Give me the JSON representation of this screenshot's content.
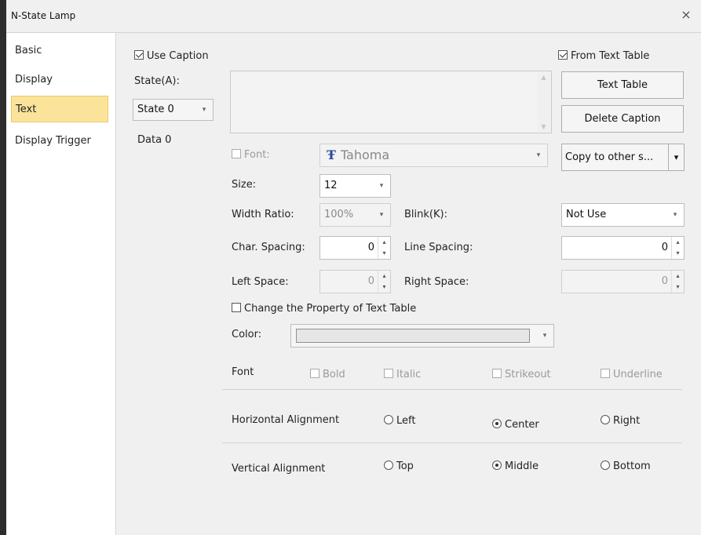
{
  "window": {
    "title": "N-State Lamp",
    "close_glyph": "×"
  },
  "nav": {
    "items": [
      "Basic",
      "Display",
      "Text",
      "Display Trigger"
    ],
    "selected": "Text"
  },
  "caption": {
    "use_caption_label": "Use Caption",
    "use_caption_checked": true,
    "from_text_table_label": "From Text Table",
    "from_text_table_checked": true,
    "state_label": "State(A):",
    "state_value": "State 0",
    "data_label": "Data 0",
    "text_table_button": "Text Table",
    "delete_caption_button": "Delete Caption"
  },
  "font": {
    "label": "Font:",
    "checked": false,
    "value": "Tahoma",
    "icon_glyph": "Ŧ",
    "copy_button": "Copy to other s...",
    "size_label": "Size:",
    "size_value": "12"
  },
  "layout_fields": {
    "width_ratio_label": "Width Ratio:",
    "width_ratio_value": "100%",
    "blink_label": "Blink(K):",
    "blink_value": "Not Use",
    "char_spacing_label": "Char. Spacing:",
    "char_spacing_value": "0",
    "line_spacing_label": "Line Spacing:",
    "line_spacing_value": "0",
    "left_space_label": "Left Space:",
    "left_space_value": "0",
    "right_space_label": "Right Space:",
    "right_space_value": "0"
  },
  "property": {
    "change_label": "Change the Property of Text Table",
    "checked": false,
    "color_label": "Color:"
  },
  "font_style": {
    "label": "Font",
    "bold": "Bold",
    "italic": "Italic",
    "strikeout": "Strikeout",
    "underline": "Underline"
  },
  "h_align": {
    "label": "Horizontal Alignment",
    "left": "Left",
    "center": "Center",
    "right": "Right",
    "selected": "Center"
  },
  "v_align": {
    "label": "Vertical Alignment",
    "top": "Top",
    "middle": "Middle",
    "bottom": "Bottom",
    "selected": "Middle"
  },
  "icons": {
    "dropdown": "▾",
    "spin_up": "▴",
    "spin_down": "▾",
    "scroll_up": "▲",
    "scroll_down": "▼"
  }
}
